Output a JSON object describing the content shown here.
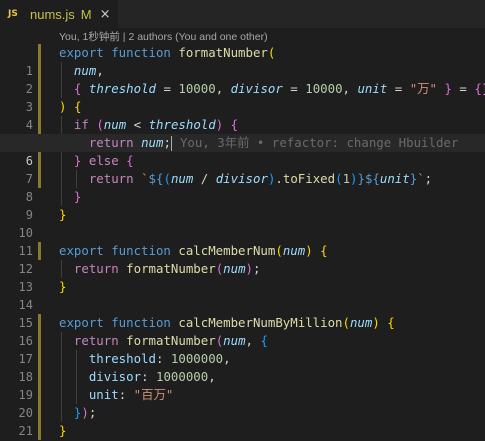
{
  "tab": {
    "icon": "JS",
    "filename": "nums.js",
    "status": "M",
    "close_icon": "×"
  },
  "codelens": "You, 1秒钟前 | 2 authors (You and one other)",
  "blame": "You, 3年前 • refactor: change Hbuilder",
  "line_numbers": [
    "1",
    "2",
    "3",
    "4",
    "5",
    "6",
    "7",
    "8",
    "9",
    "10",
    "11",
    "12",
    "13",
    "14",
    "15",
    "16",
    "17",
    "18",
    "19",
    "20",
    "21",
    "22"
  ],
  "current_line": 6,
  "colors": {
    "keyword": "#569cd6",
    "control": "#c586c0",
    "function": "#dcdcaa",
    "variable": "#9cdcfe",
    "number": "#b5cea8",
    "string": "#ce9178",
    "tab_text_modified": "#c8c04a"
  },
  "code": {
    "l1": {
      "kw": "export function",
      "fn": "formatNumber",
      "open": "("
    },
    "l2": {
      "param": "num",
      "comma": ","
    },
    "l3": {
      "open": "{",
      "p1": "threshold",
      "eq1": " = ",
      "v1": "10000",
      "c1": ", ",
      "p2": "divisor",
      "eq2": " = ",
      "v2": "10000",
      "c2": ", ",
      "p3": "unit",
      "eq3": " = ",
      "v3": "\"万\"",
      "close": "}",
      "eq4": " = ",
      "def": "{}"
    },
    "l4": {
      "close": ")",
      "open": "{"
    },
    "l5": {
      "kw": "if",
      "open": "(",
      "a": "num",
      "op": " < ",
      "b": "threshold",
      "close": ")",
      "brace": "{"
    },
    "l6": {
      "kw": "return",
      "v": "num",
      "semi": ";"
    },
    "l7": {
      "close": "}",
      "kw": "else",
      "open": "{"
    },
    "l8": {
      "kw": "return",
      "tick1": "`",
      "ds1": "${",
      "open": "(",
      "a": "num",
      "op": " / ",
      "b": "divisor",
      "close": ")",
      "dot": ".",
      "m": "toFixed",
      "mo": "(",
      "n": "1",
      "mc": ")",
      "de1": "}",
      "ds2": "${",
      "u": "unit",
      "de2": "}",
      "tick2": "`",
      "semi": ";"
    },
    "l9": {
      "close": "}"
    },
    "l10": {
      "close": "}"
    },
    "l12": {
      "kw": "export function",
      "fn": "calcMemberNum",
      "open": "(",
      "param": "num",
      "close": ")",
      "brace": "{"
    },
    "l13": {
      "kw": "return",
      "fn": "formatNumber",
      "open": "(",
      "v": "num",
      "close": ")",
      "semi": ";"
    },
    "l14": {
      "close": "}"
    },
    "l16": {
      "kw": "export function",
      "fn": "calcMemberNumByMillion",
      "open": "(",
      "param": "num",
      "close": ")",
      "brace": "{"
    },
    "l17": {
      "kw": "return",
      "fn": "formatNumber",
      "open": "(",
      "v": "num",
      "comma": ", ",
      "brace": "{"
    },
    "l18": {
      "k": "threshold",
      "colon": ": ",
      "v": "1000000",
      "comma": ","
    },
    "l19": {
      "k": "divisor",
      "colon": ": ",
      "v": "1000000",
      "comma": ","
    },
    "l20": {
      "k": "unit",
      "colon": ": ",
      "v": "\"百万\""
    },
    "l21": {
      "brace": "}",
      "close": ")",
      "semi": ";"
    },
    "l22": {
      "close": "}"
    }
  }
}
